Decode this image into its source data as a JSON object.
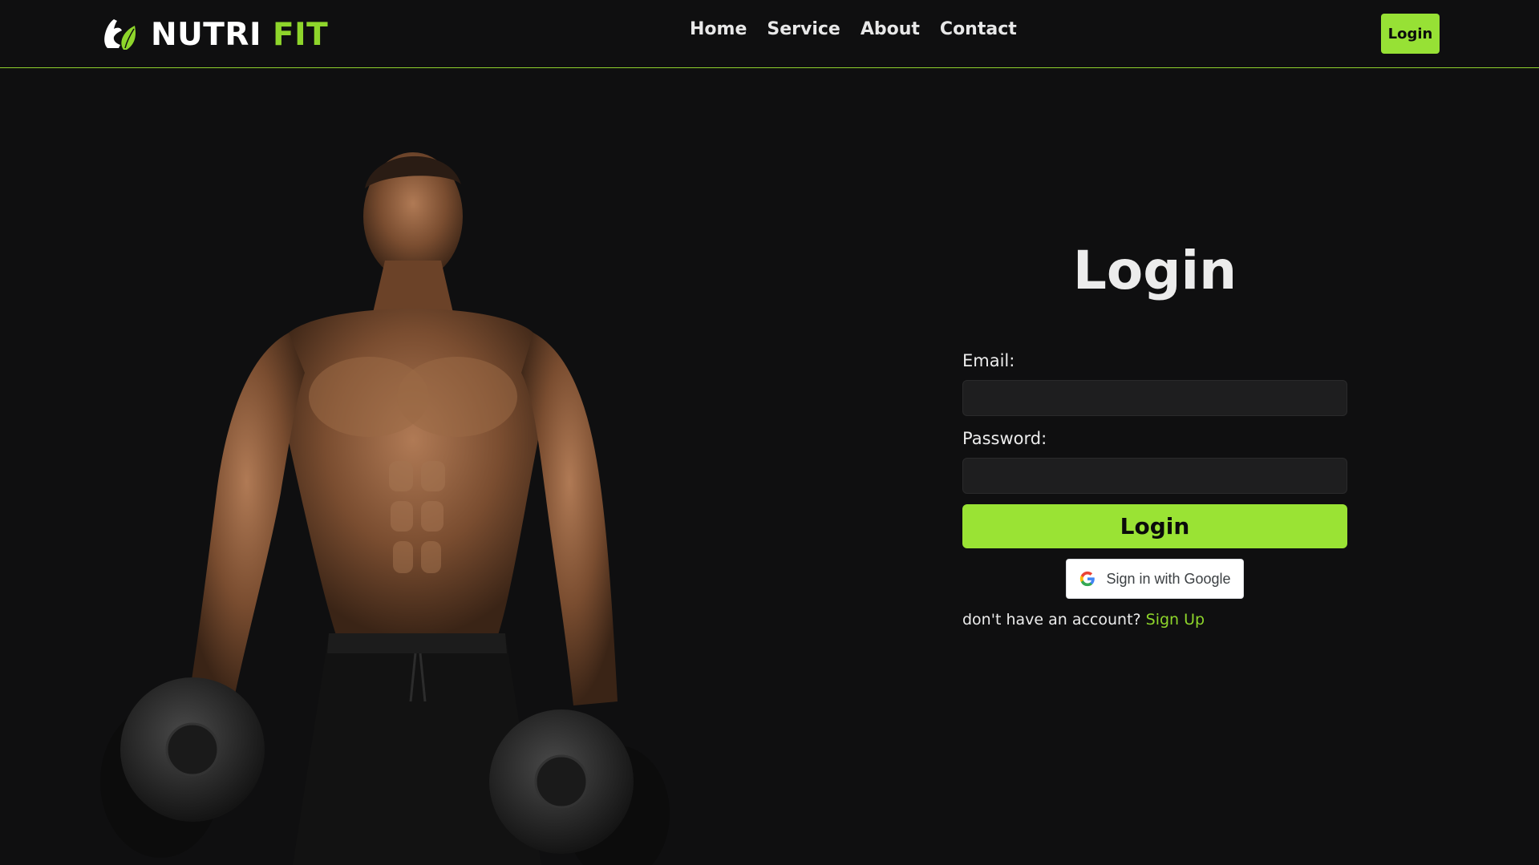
{
  "brand": {
    "name": "NUTRI",
    "accent": "FIT",
    "accent_color": "#8ed52b",
    "icon": "flexed-arm-leaf-icon"
  },
  "nav": {
    "items": [
      {
        "label": "Home"
      },
      {
        "label": "Service"
      },
      {
        "label": "About"
      },
      {
        "label": "Contact"
      }
    ],
    "login_label": "Login"
  },
  "hero": {
    "image": "muscular-man-with-dumbbells-photo"
  },
  "login": {
    "title": "Login",
    "email_label": "Email:",
    "email_value": "",
    "password_label": "Password:",
    "password_value": "",
    "submit_label": "Login",
    "google_label": "Sign in with Google",
    "signup_prompt": "don't have an account?",
    "signup_link": "Sign Up"
  },
  "colors": {
    "background": "#0f0f10",
    "accent": "#97e135",
    "input_bg": "#1e1e1f"
  }
}
